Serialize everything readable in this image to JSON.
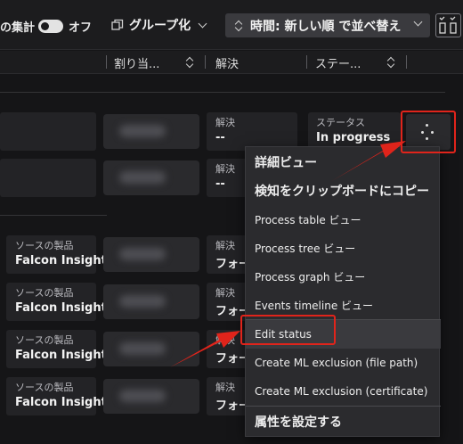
{
  "toolbar": {
    "aggregate_label": "の集計",
    "toggle_label": "オフ",
    "group_label": "グループ化",
    "sort_label": "時間: 新しい順 で並べ替え",
    "columns_icon": "columns-icon"
  },
  "columns": {
    "assign": "割り当...",
    "resolution": "解決",
    "status": "ステー..."
  },
  "rows": [
    {
      "resolution_label": "解決",
      "resolution_value": "--",
      "status_label": "ステータス",
      "status_value": "In progress"
    },
    {
      "resolution_label": "解決",
      "resolution_value": "--"
    },
    {
      "product_label": "ソースの製品",
      "product_value": "Falcon Insight",
      "resolution_label": "解決",
      "resolution_value": "フォー"
    },
    {
      "product_label": "ソースの製品",
      "product_value": "Falcon Insight",
      "resolution_label": "解決",
      "resolution_value": "フォー"
    },
    {
      "product_label": "ソースの製品",
      "product_value": "Falcon Insight",
      "resolution_label": "解決",
      "resolution_value": "フォー"
    },
    {
      "product_label": "ソースの製品",
      "product_value": "Falcon Insight",
      "resolution_label": "解決",
      "resolution_value": "フォー"
    }
  ],
  "menu": {
    "items": [
      {
        "label": "詳細ビュー"
      },
      {
        "label": "検知をクリップボードにコピー"
      },
      {
        "label": "Process table ビュー"
      },
      {
        "label": "Process tree ビュー"
      },
      {
        "label": "Process graph ビュー"
      },
      {
        "label": "Events timeline ビュー"
      },
      {
        "label": "Edit status"
      },
      {
        "label": "Create ML exclusion (file path)"
      },
      {
        "label": "Create ML exclusion (certificate)"
      },
      {
        "label": "属性を設定する"
      }
    ]
  },
  "colors": {
    "annotation_red": "#e0241b",
    "background": "#151517",
    "card": "#232326"
  }
}
